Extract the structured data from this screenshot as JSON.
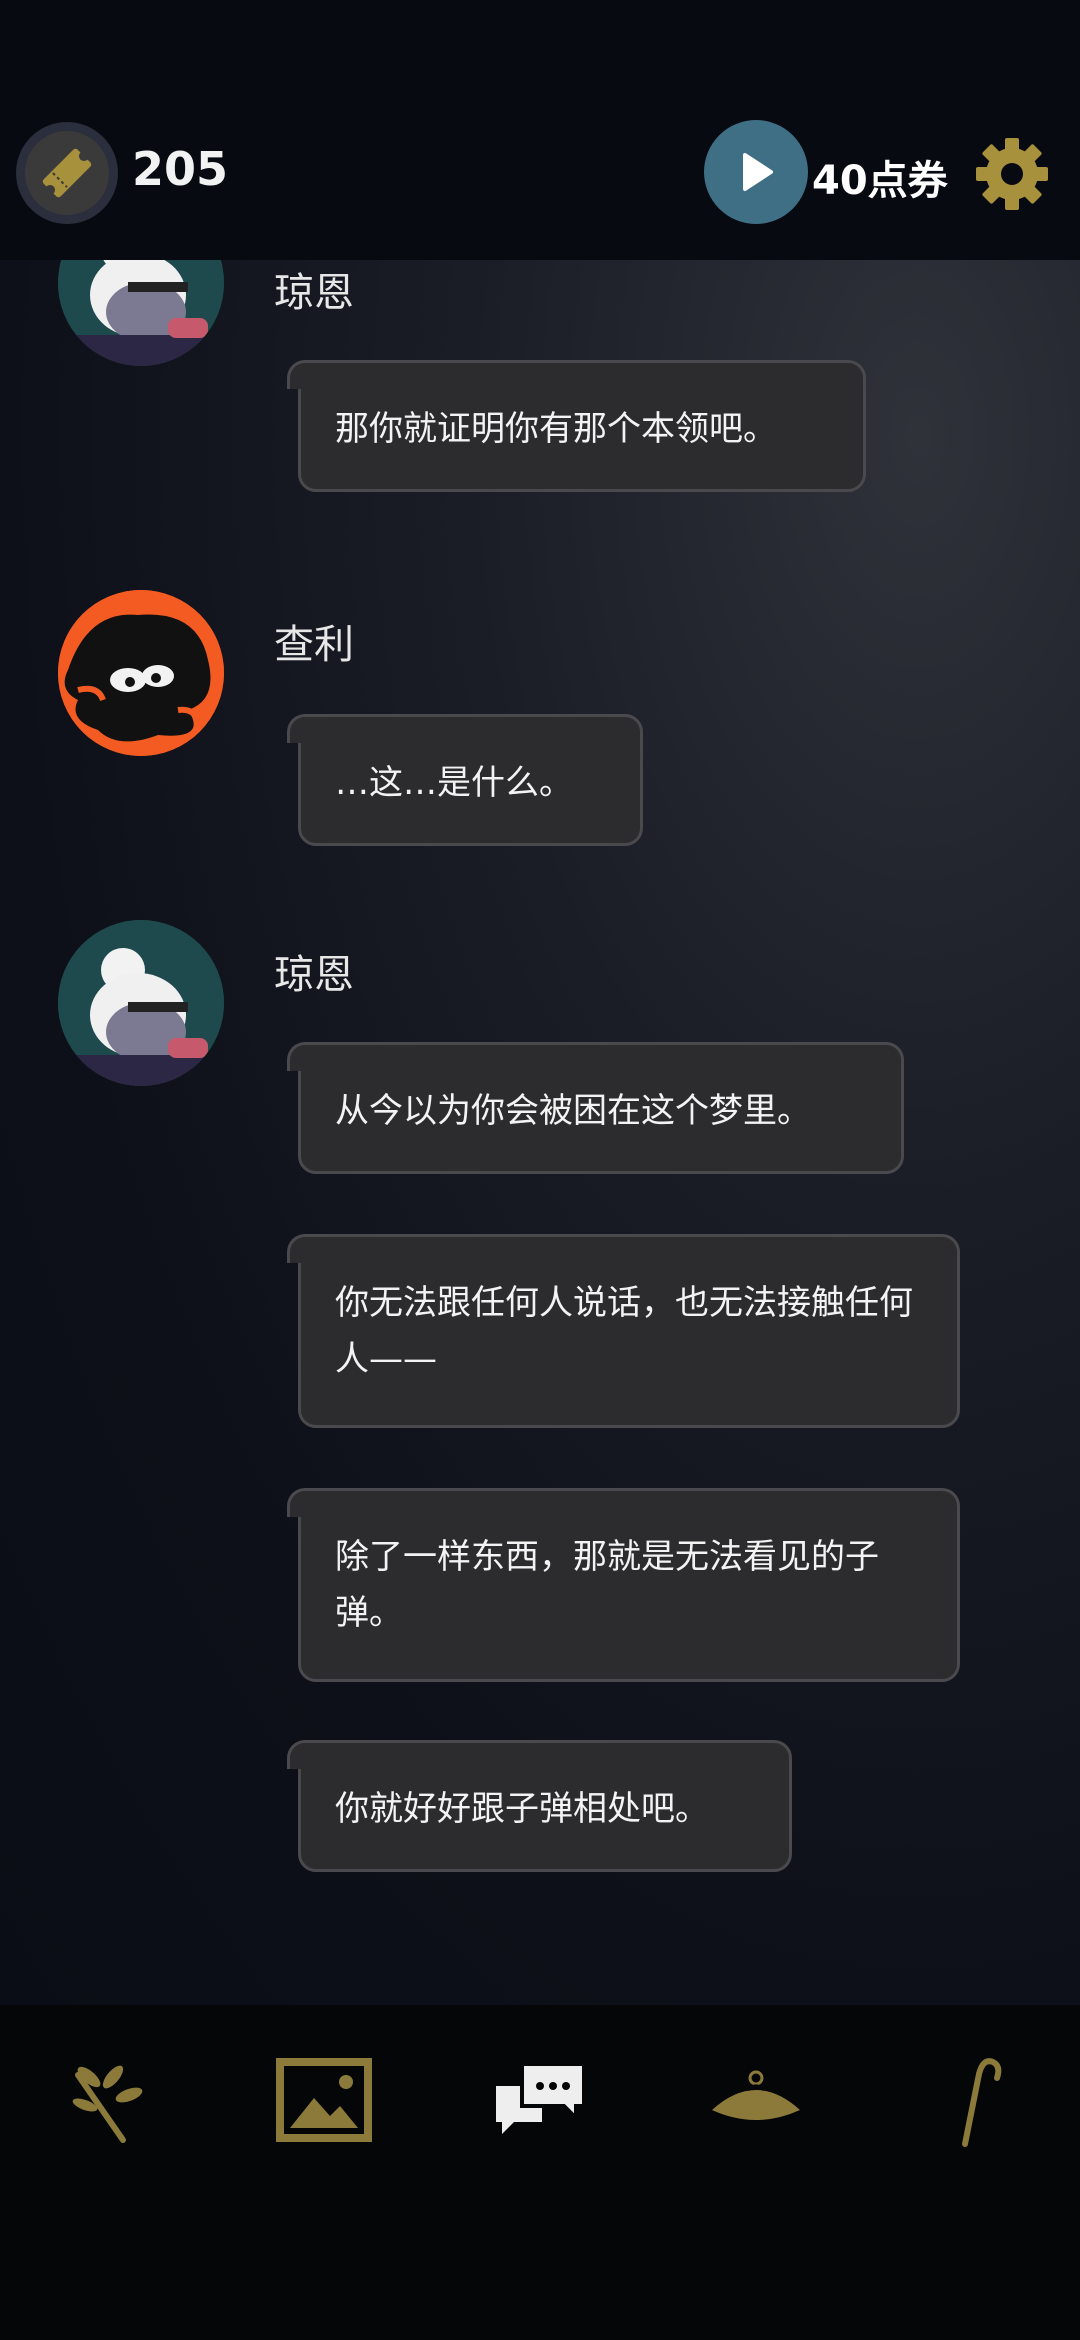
{
  "header": {
    "ticket_count": "205",
    "video_reward_label": "40点券",
    "icons": [
      "ticket-icon",
      "play-icon",
      "gear-icon"
    ]
  },
  "colors": {
    "accent_gold": "#a8913d",
    "video_button": "#3f6f85",
    "bubble_bg": "#2c2c2f",
    "bubble_border": "#4a4a4e"
  },
  "messages": [
    {
      "speaker": "琼恩",
      "text": "那你就证明你有那个本领吧。"
    },
    {
      "speaker": "查利",
      "text": "…这…是什么。"
    },
    {
      "speaker": "琼恩",
      "text": "从今以为你会被困在这个梦里。"
    },
    {
      "speaker": "",
      "text": "你无法跟任何人说话，也无法接触任何人——"
    },
    {
      "speaker": "",
      "text": "除了一样东西，那就是无法看见的子弹。"
    },
    {
      "speaker": "",
      "text": "你就好好跟子弹相处吧。"
    }
  ],
  "bottom_nav": [
    "branch-icon",
    "gallery-icon",
    "chat-icon",
    "hat-icon",
    "cane-icon"
  ]
}
